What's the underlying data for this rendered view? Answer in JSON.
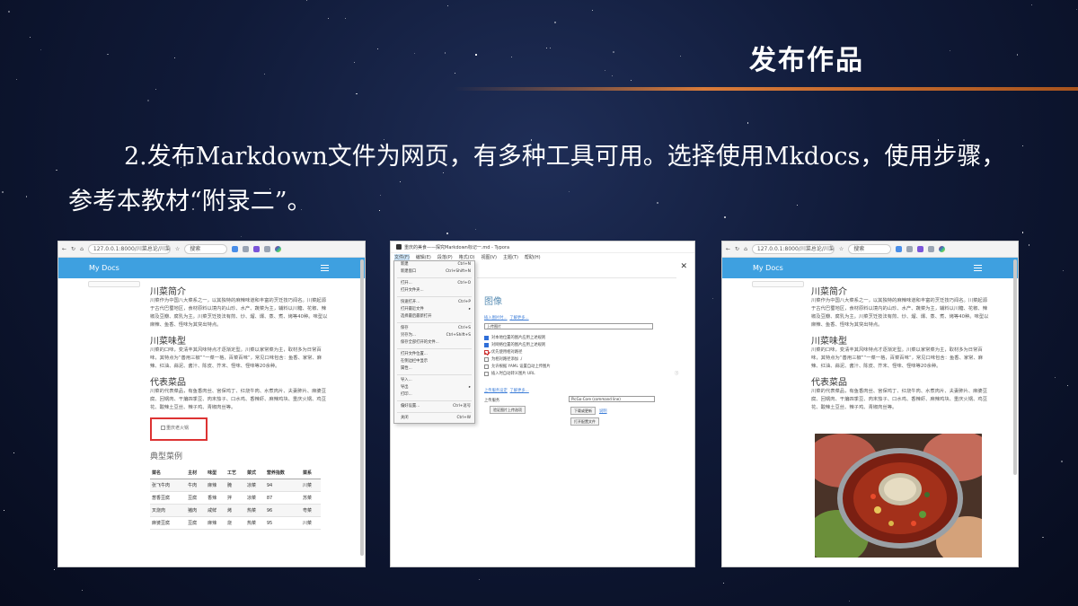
{
  "slide": {
    "title": "发布作品",
    "body": "2.发布Markdown文件为网页，有多种工具可用。选择使用Mkdocs，使用步骤，参考本教材“附录二”。"
  },
  "colors": {
    "accent_line": "#d97b3a",
    "header_blue": "#3ea0e0",
    "broken_img_border": "#dd3333"
  },
  "browser_left": {
    "url": "127.0.0.1:8000/川菜总论/川菜",
    "search_placeholder": "搜索",
    "site_name": "My Docs",
    "sections": [
      {
        "heading": "川菜简介",
        "text": "川菜作为中国八大菜系之一，以其独特的麻辣味道和丰富的烹饪技巧闻名。川菜起源于古代巴蜀地区，食材原料以境内的山珍、水产、蔬菜为主，辅料以川糖、花椒、辣椒及豆瓣、腐乳为主。川菜烹饪技法有煎、炒、熘、爆、蒸、煮、烤等40种。味型以麻辣、鱼香、怪味为其突出特点。"
      },
      {
        "heading": "川菜味型",
        "text": "川菜的口味，变清丰其风味特点才逐渐定型。川菜以家常菜为主，取材多为日常百味，其特点为“善用三椒”“一菜一格，百菜百味”，常见口味包含：鱼香、家常、麻辣、红油、蒜泥、酱汁、陈皮、芥末、怪味、怪味等20余种。"
      },
      {
        "heading": "代表菜品",
        "text": "川菜的代表菜品，有鱼香肉丝、宫保鸡丁、红烧牛肉、水煮肉片、夫妻肺片、麻婆豆腐、回锅肉、干煸四季豆、肉末茄子、口水鸡、香辣虾、麻辣鸡块、重庆火锅、鸡豆花、酸辣土豆丝、辣子鸡、青椒肉丝等。"
      }
    ],
    "broken_image_alt": "重庆老火锅",
    "table_title": "典型菜例",
    "table": {
      "headers": [
        "菜名",
        "主材",
        "味型",
        "工艺",
        "菜式",
        "营养指数",
        "菜系"
      ],
      "rows": [
        [
          "张飞牛肉",
          "牛肉",
          "麻辣",
          "腌",
          "凉菜",
          "94",
          "川菜"
        ],
        [
          "葱香豆腐",
          "豆腐",
          "香辣",
          "拌",
          "凉菜",
          "87",
          "苏菜"
        ],
        [
          "叉烧肉",
          "猪肉",
          "咸鲜",
          "烤",
          "热菜",
          "96",
          "粤菜"
        ],
        [
          "麻婆豆腐",
          "豆腐",
          "麻辣",
          "烧",
          "热菜",
          "95",
          "川菜"
        ]
      ]
    }
  },
  "typora": {
    "window_title": "重庆的美食——探究Markdown标记一.md - Typora",
    "menu": [
      "文件(F)",
      "编辑(E)",
      "段落(P)",
      "格式(O)",
      "视图(V)",
      "主题(T)",
      "帮助(H)"
    ],
    "file_menu": [
      {
        "label": "新建",
        "shortcut": "Ctrl+N"
      },
      {
        "label": "新建窗口",
        "shortcut": "Ctrl+Shift+N"
      },
      {
        "sep": true
      },
      {
        "label": "打开...",
        "shortcut": "Ctrl+O"
      },
      {
        "label": "打开文件夹...",
        "shortcut": ""
      },
      {
        "sep": true
      },
      {
        "label": "快速打开...",
        "shortcut": "Ctrl+P"
      },
      {
        "label": "打开最近文件",
        "shortcut": "▸"
      },
      {
        "label": "选择最后最新打开",
        "shortcut": ""
      },
      {
        "sep": true
      },
      {
        "label": "保存",
        "shortcut": "Ctrl+S"
      },
      {
        "label": "另存为...",
        "shortcut": "Ctrl+Shift+S"
      },
      {
        "label": "保存全部打开的文件...",
        "shortcut": ""
      },
      {
        "sep": true
      },
      {
        "label": "打开文件位置...",
        "shortcut": ""
      },
      {
        "label": "在侧边栏中显示",
        "shortcut": ""
      },
      {
        "label": "属性...",
        "shortcut": ""
      },
      {
        "sep": true
      },
      {
        "label": "导入...",
        "shortcut": ""
      },
      {
        "label": "导出",
        "shortcut": "▸"
      },
      {
        "label": "打印...",
        "shortcut": ""
      },
      {
        "sep": true
      },
      {
        "label": "偏好设置...",
        "shortcut": "Ctrl+逗号"
      },
      {
        "sep": true
      },
      {
        "label": "关闭",
        "shortcut": "Ctrl+W"
      }
    ],
    "pref_title": "图像",
    "insert_label": "插入图片时...",
    "insert_link": "了解更多...",
    "insert_select": "上传图片",
    "checkboxes": [
      {
        "label": "对本地位置的图片应用上述规则",
        "checked": true
      },
      {
        "label": "对网络位置的图片应用上述规则",
        "checked": true
      },
      {
        "label": "优先使用相对路径",
        "checked": true
      },
      {
        "label": "为相对路径添加 ./",
        "checked": false
      },
      {
        "label": "允许根据 YAML 设置自动上传图片",
        "checked": false
      },
      {
        "label": "插入时自动转义图片 URL",
        "checked": false
      }
    ],
    "upload_label": "上传服务设定",
    "upload_link": "了解更多...",
    "uploader_label": "上传服务",
    "uploader_select": "PicGo-Core (command line)",
    "btn_verify": "验证图片上传选项",
    "btn_download": "下载或更新",
    "btn_download_link": "说明",
    "btn_open_config": "打开配置文件"
  },
  "browser_right": {
    "url": "127.0.0.1:8000/川菜总论/川菜",
    "search_placeholder": "搜索",
    "site_name": "My Docs",
    "sections": [
      {
        "heading": "川菜简介",
        "text": "川菜作为中国八大菜系之一，以其独特的麻辣味道和丰富的烹饪技巧闻名。川菜起源于古代巴蜀地区，食材原料以境内的山珍、水产、蔬菜为主，辅料以川糖、花椒、辣椒及豆瓣、腐乳为主。川菜烹饪技法有煎、炒、熘、爆、蒸、煮、烤等40种。味型以麻辣、鱼香、怪味为其突出特点。"
      },
      {
        "heading": "川菜味型",
        "text": "川菜的口味，变清丰其风味特点才逐渐定型。川菜以家常菜为主，取材多为日常百味，其特点为“善用三椒”“一菜一格，百菜百味”，常见口味包含：鱼香、家常、麻辣、红油、蒜泥、酱汁、陈皮、芥末、怪味、怪味等20余种。"
      },
      {
        "heading": "代表菜品",
        "text": "川菜的代表菜品，有鱼香肉丝、宫保鸡丁、红烧牛肉、水煮肉片、夫妻肺片、麻婆豆腐、回锅肉、干煸四季豆、肉末茄子、口水鸡、香辣虾、麻辣鸡块、重庆火锅、鸡豆花、酸辣土豆丝、辣子鸡、青椒肉丝等。"
      }
    ]
  }
}
